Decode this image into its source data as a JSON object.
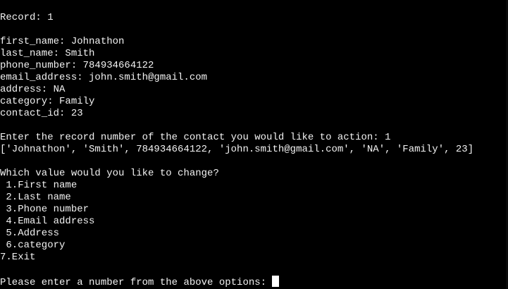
{
  "colors": {
    "background": "#000000",
    "foreground": "#f2f2f2",
    "cursor": "#ffffff"
  },
  "record_header": "Record: 1",
  "fields": [
    "first_name: Johnathon",
    "last_name: Smith",
    "phone_number: 784934664122",
    "email_address: john.smith@gmail.com",
    "address: NA",
    "category: Family",
    "contact_id: 23"
  ],
  "action_prompt": "Enter the record number of the contact you would like to action: 1",
  "record_list": "['Johnathon', 'Smith', 784934664122, 'john.smith@gmail.com', 'NA', 'Family', 23]",
  "change_question": "Which value would you like to change?",
  "options": [
    " 1.First name",
    " 2.Last name",
    " 3.Phone number",
    " 4.Email address",
    " 5.Address",
    " 6.category",
    "7.Exit"
  ],
  "input_prompt": "Please enter a number from the above options: ",
  "cursor_icon": "block-cursor"
}
